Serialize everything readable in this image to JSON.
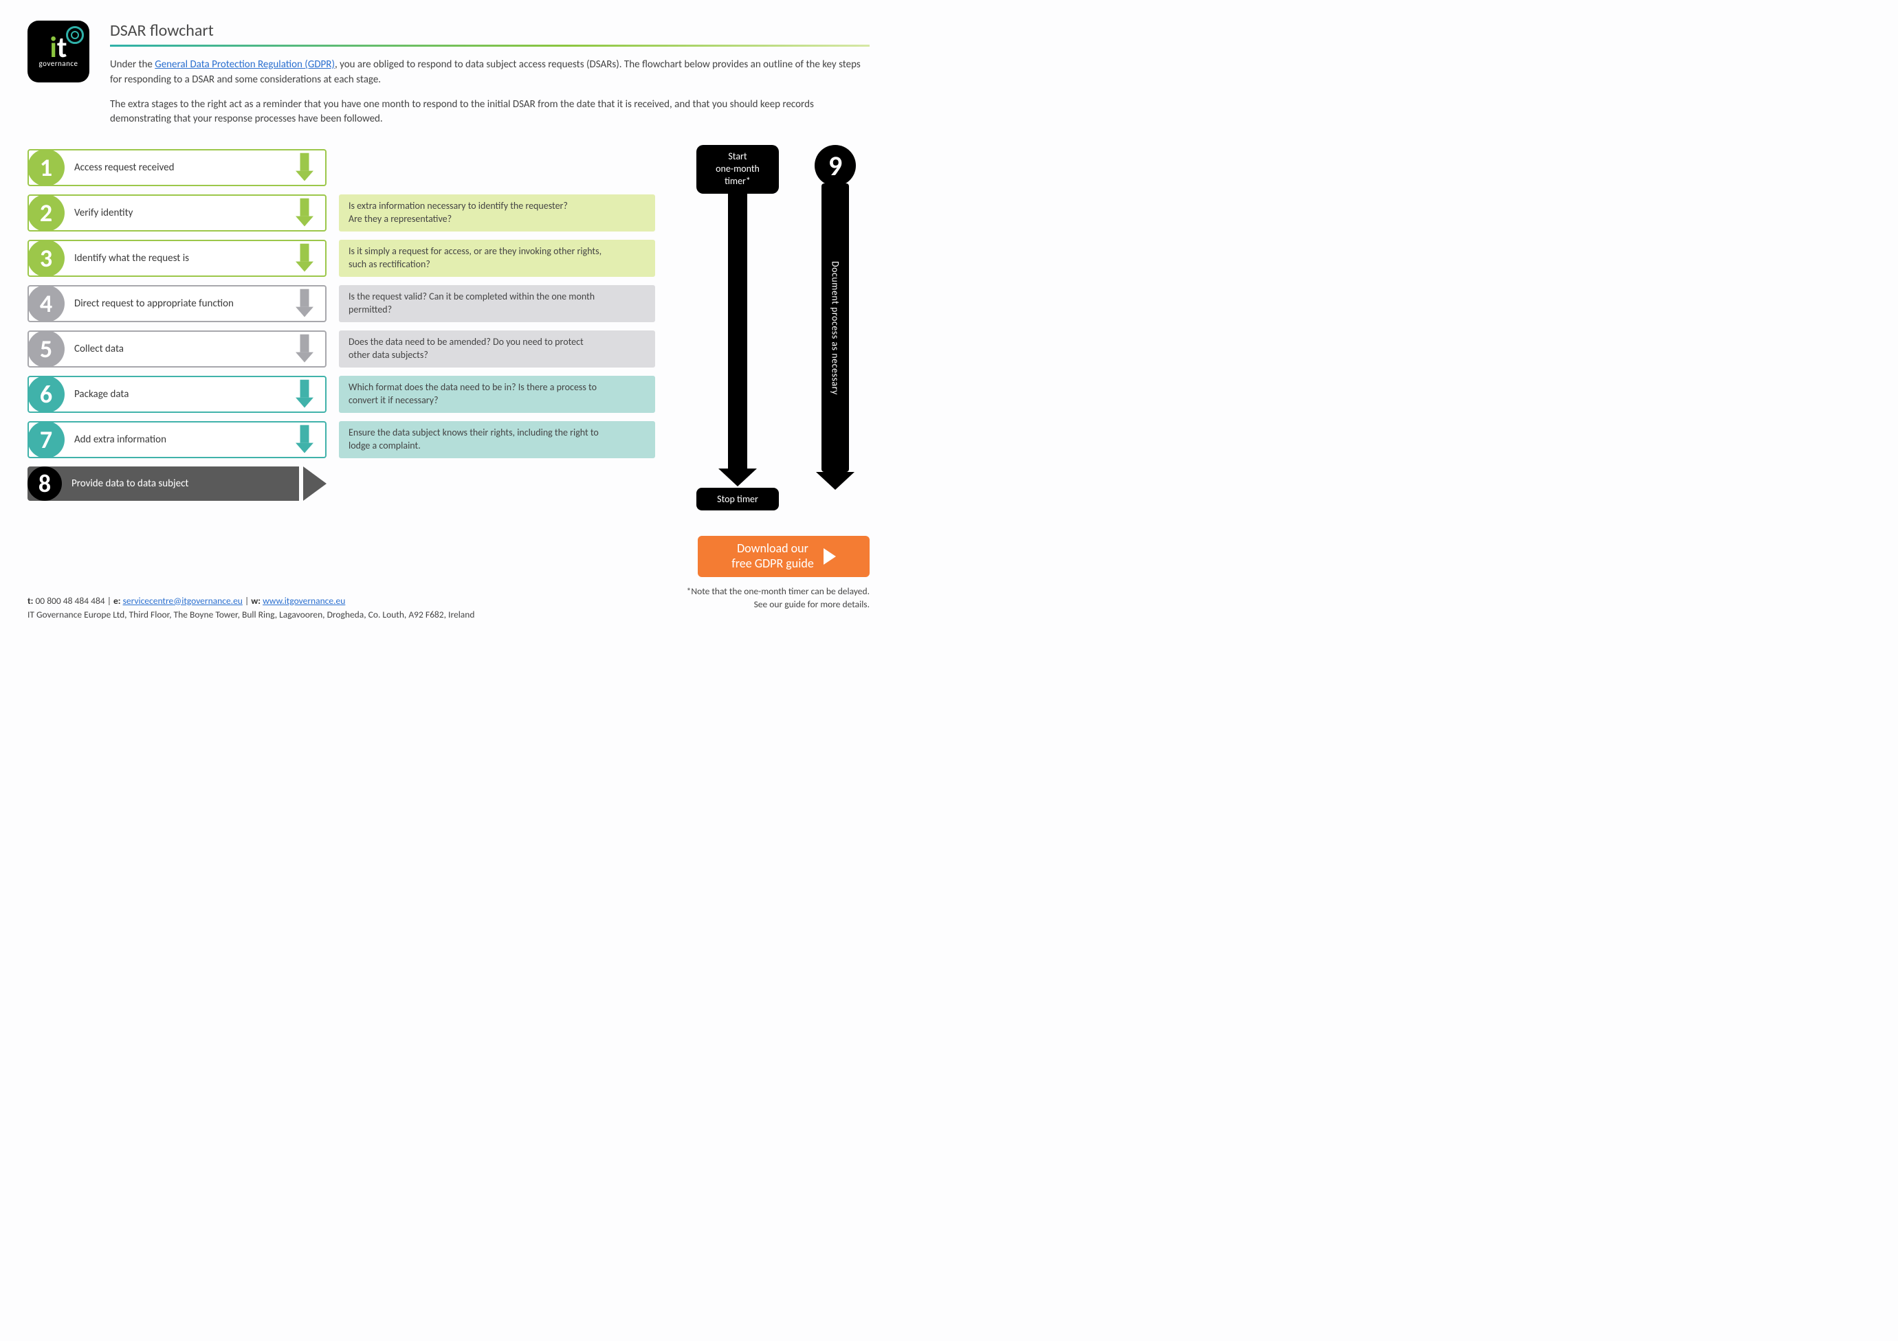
{
  "logo": {
    "it_i": "i",
    "it_t": "t",
    "gov": "governance"
  },
  "title": "DSAR flowchart",
  "intro": {
    "pre": "Under the ",
    "link": "General Data Protection Regulation (GDPR)",
    "post": ", you are obliged to respond to data subject access requests (DSARs). The flowchart below provides an outline of the key steps for responding to a DSAR and some considerations at each stage.",
    "p2": "The extra stages to the right act as a reminder that you have one month to respond to the initial DSAR from the date that it is received, and that you should keep records demonstrating that your response processes have been followed."
  },
  "steps": [
    {
      "n": "1",
      "label": "Access request received",
      "cls": "green",
      "note": null
    },
    {
      "n": "2",
      "label": "Verify identity",
      "cls": "green",
      "note": {
        "l1": "Is extra information necessary to identify the requester?",
        "l2": "Are they a representative?",
        "ncls": "green-light"
      }
    },
    {
      "n": "3",
      "label": "Identify what the request is",
      "cls": "green",
      "note": {
        "l1": "Is it simply a request for access, or are they invoking other rights,",
        "l2": "such as rectification?",
        "ncls": "green-light"
      }
    },
    {
      "n": "4",
      "label": "Direct request to appropriate function",
      "cls": "grey",
      "note": {
        "l1": "Is the request valid? Can it be completed within the one month",
        "l2": "permitted?",
        "ncls": "grey-light"
      }
    },
    {
      "n": "5",
      "label": "Collect data",
      "cls": "grey",
      "note": {
        "l1": "Does the data need to be amended? Do you need to protect",
        "l2": "other data subjects?",
        "ncls": "grey-light"
      }
    },
    {
      "n": "6",
      "label": "Package data",
      "cls": "teal",
      "note": {
        "l1": "Which format does the data need to be in? Is there a process to",
        "l2": "convert it if necessary?",
        "ncls": "teal-light"
      }
    },
    {
      "n": "7",
      "label": "Add extra information",
      "cls": "teal",
      "note": {
        "l1": "Ensure the data subject knows their rights, including the right to",
        "l2": "lodge a complaint.",
        "ncls": "teal-light"
      }
    },
    {
      "n": "8",
      "label": "Provide data to data subject",
      "cls": "black",
      "note": null
    }
  ],
  "timer": {
    "start_l1": "Start",
    "start_l2": "one-month",
    "start_l3": "timer*",
    "stop": "Stop timer"
  },
  "doc": {
    "n": "9",
    "label": "Document process as necessary"
  },
  "cta": {
    "l1": "Download our",
    "l2": "free GDPR guide"
  },
  "footnote": {
    "l1": "*Note that the one-month timer can be delayed.",
    "l2": "See our guide for more details."
  },
  "footer": {
    "t_label": "t:",
    "t": "00 800 48 484 484",
    "sep": " | ",
    "e_label": "e:",
    "e": "servicecentre@itgovernance.eu",
    "w_label": "w:",
    "w": "www.itgovernance.eu",
    "addr": "IT Governance Europe Ltd, Third Floor, The Boyne Tower, Bull Ring, Lagavooren, Drogheda, Co. Louth, A92 F682, Ireland"
  }
}
